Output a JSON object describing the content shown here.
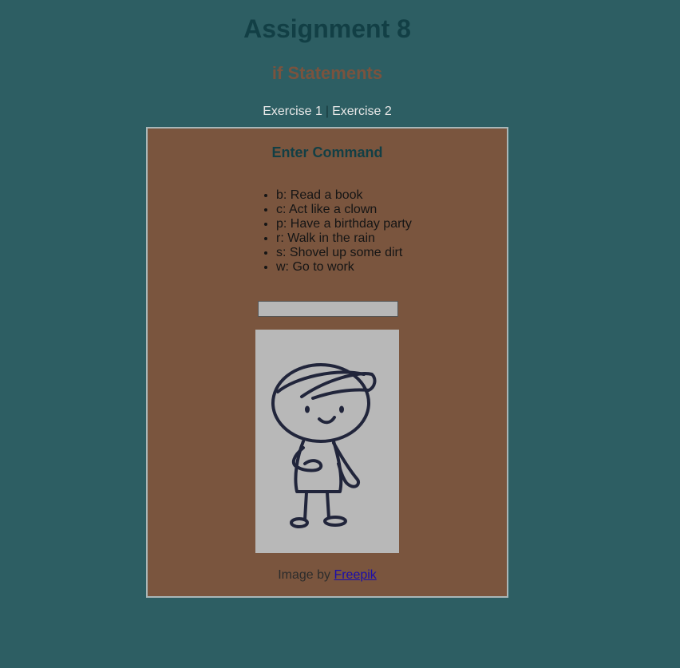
{
  "header": {
    "title": "Assignment 8",
    "subtitle": "if Statements"
  },
  "nav": {
    "items": [
      {
        "label": "Exercise 1"
      },
      {
        "label": "Exercise 2"
      }
    ],
    "separator": "|"
  },
  "panel": {
    "title": "Enter Command",
    "commands": [
      {
        "label": "b: Read a book"
      },
      {
        "label": "c: Act like a clown"
      },
      {
        "label": "p: Have a birthday party"
      },
      {
        "label": "r: Walk in the rain"
      },
      {
        "label": "s: Shovel up some dirt"
      },
      {
        "label": "w: Go to work"
      }
    ],
    "input": {
      "value": "",
      "placeholder": ""
    },
    "image": {
      "icon": "stick-figure-cap-illustration"
    },
    "credit": {
      "prefix": "Image by ",
      "link_label": "Freepik"
    }
  },
  "colors": {
    "background": "#2d5e63",
    "panel": "#7a553e",
    "title": "#123f45",
    "subtitle": "#7a533e",
    "link": "#1a0dab"
  }
}
